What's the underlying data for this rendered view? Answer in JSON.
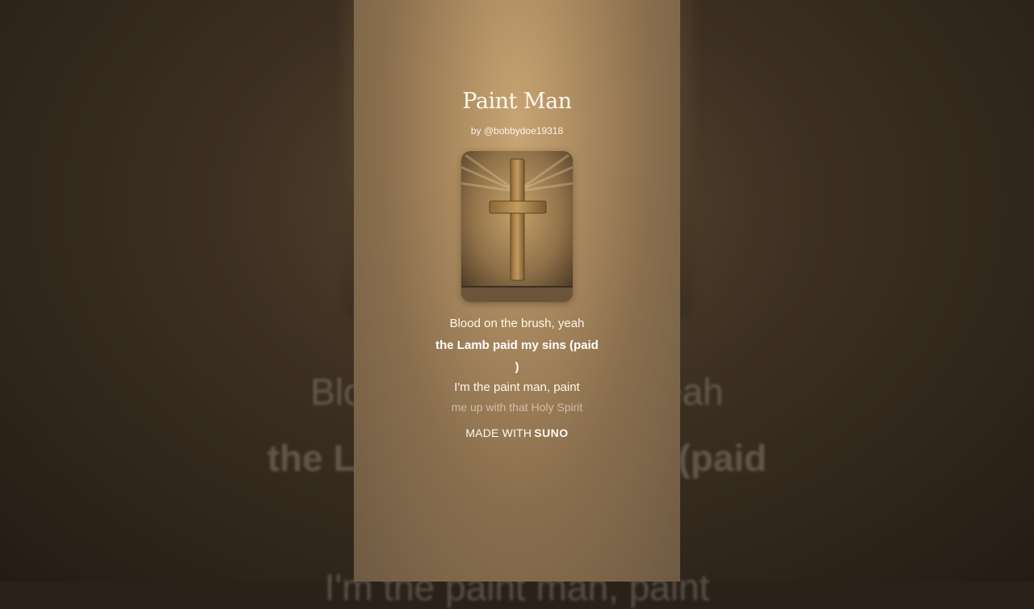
{
  "song": {
    "title": "Paint Man",
    "byline": "by @bobbydoe19318"
  },
  "artwork": {
    "icon": "cross-icon",
    "colors": {
      "background": "#8a6d45",
      "cross": "#b08a55"
    }
  },
  "lyrics": {
    "line1": "Blood on the brush, yeah",
    "line2a": "the Lamb paid my sins (paid",
    "line2b": ")",
    "line3": "I'm the paint man, paint",
    "line4": "me up with that Holy Spirit"
  },
  "background_lyrics": {
    "l1": "Blood on the brush, yeah",
    "l2": "the Lamb paid my sins (paid",
    "l3": "I'm the paint man, paint"
  },
  "footer": {
    "made_with": "MADE WITH",
    "brand": "SUNO"
  }
}
